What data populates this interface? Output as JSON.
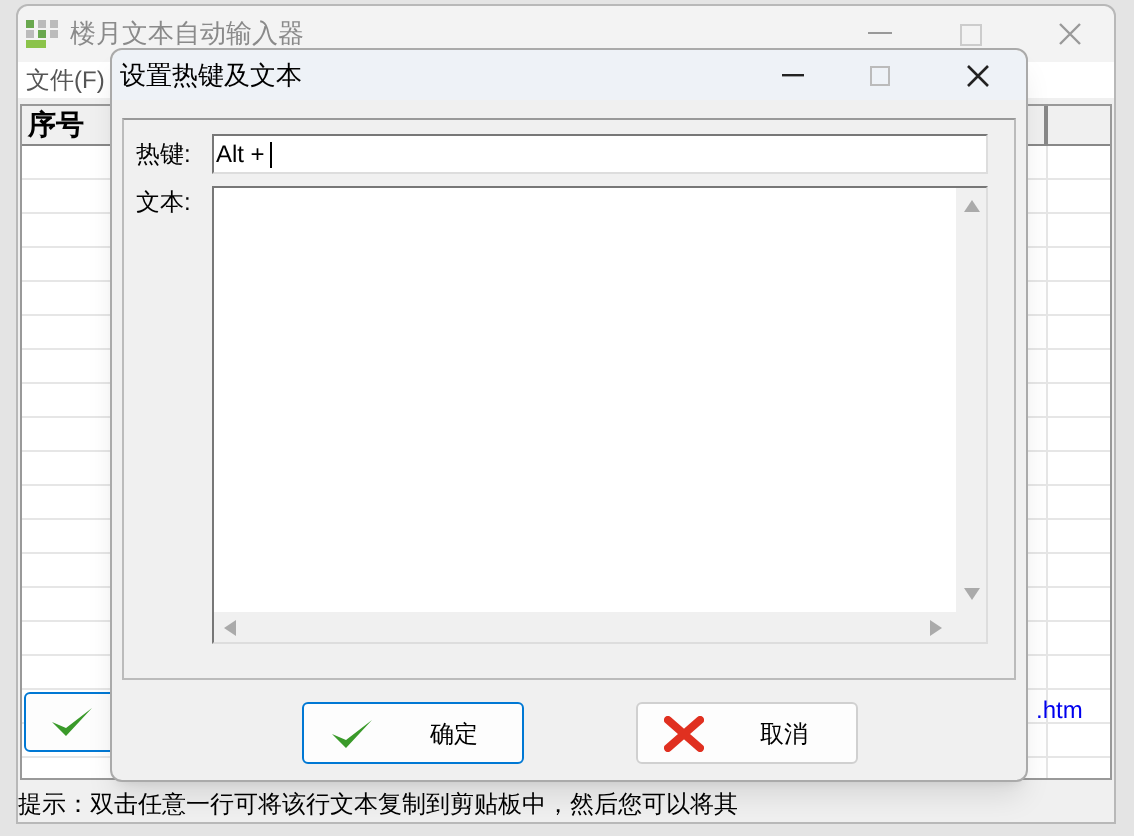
{
  "main_window": {
    "title": "楼月文本自动输入器",
    "menu": [
      "文件(F)"
    ],
    "table": {
      "columns": [
        "序号"
      ]
    },
    "link": ".htm",
    "status_bar": "提示：双击任意一行可将该行文本复制到剪贴板中，然后您可以将其"
  },
  "dialog": {
    "title": "设置热键及文本",
    "fields": [
      {
        "kind": "line",
        "label": "热键:",
        "value": "Alt +"
      },
      {
        "kind": "area",
        "label": "文本:"
      }
    ],
    "buttons": [
      {
        "kind": "ok",
        "label": "确定",
        "focused": true
      },
      {
        "kind": "cancel",
        "label": "取消",
        "focused": false
      }
    ]
  }
}
